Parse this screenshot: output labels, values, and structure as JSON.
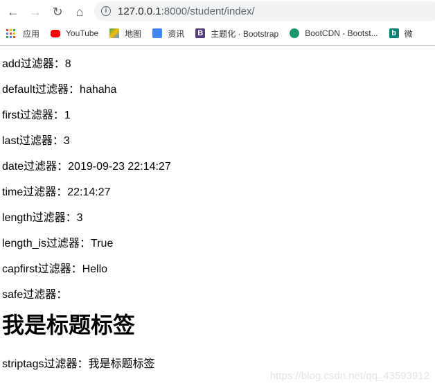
{
  "browser": {
    "url_host": "127.0.0.1",
    "url_path": ":8000/student/index/"
  },
  "bookmarks": [
    {
      "label": "应用",
      "icon": "apps-grid-icon"
    },
    {
      "label": "YouTube",
      "icon": "youtube-icon",
      "color": "#ff0000"
    },
    {
      "label": "地图",
      "icon": "maps-icon",
      "color": "#34a853"
    },
    {
      "label": "资讯",
      "icon": "news-icon",
      "color": "#4285f4"
    },
    {
      "label": "主题化 · Bootstrap",
      "icon": "bootstrap-icon",
      "color": "#563d7c"
    },
    {
      "label": "BootCDN - Bootst...",
      "icon": "bootcdn-icon",
      "color": "#1a9a6c"
    },
    {
      "label": "微",
      "icon": "bing-icon",
      "color": "#008373"
    }
  ],
  "lines": [
    "add过滤器：8",
    "default过滤器：hahaha",
    "first过滤器：1",
    "last过滤器：3",
    "date过滤器：2019-09-23 22:14:27",
    "time过滤器：22:14:27",
    "length过滤器：3",
    "length_is过滤器：True",
    "capfirst过滤器：Hello",
    "safe过滤器："
  ],
  "heading": "我是标题标签",
  "striptags": "striptags过滤器：我是标题标签",
  "watermark": "https://blog.csdn.net/qq_43593912"
}
